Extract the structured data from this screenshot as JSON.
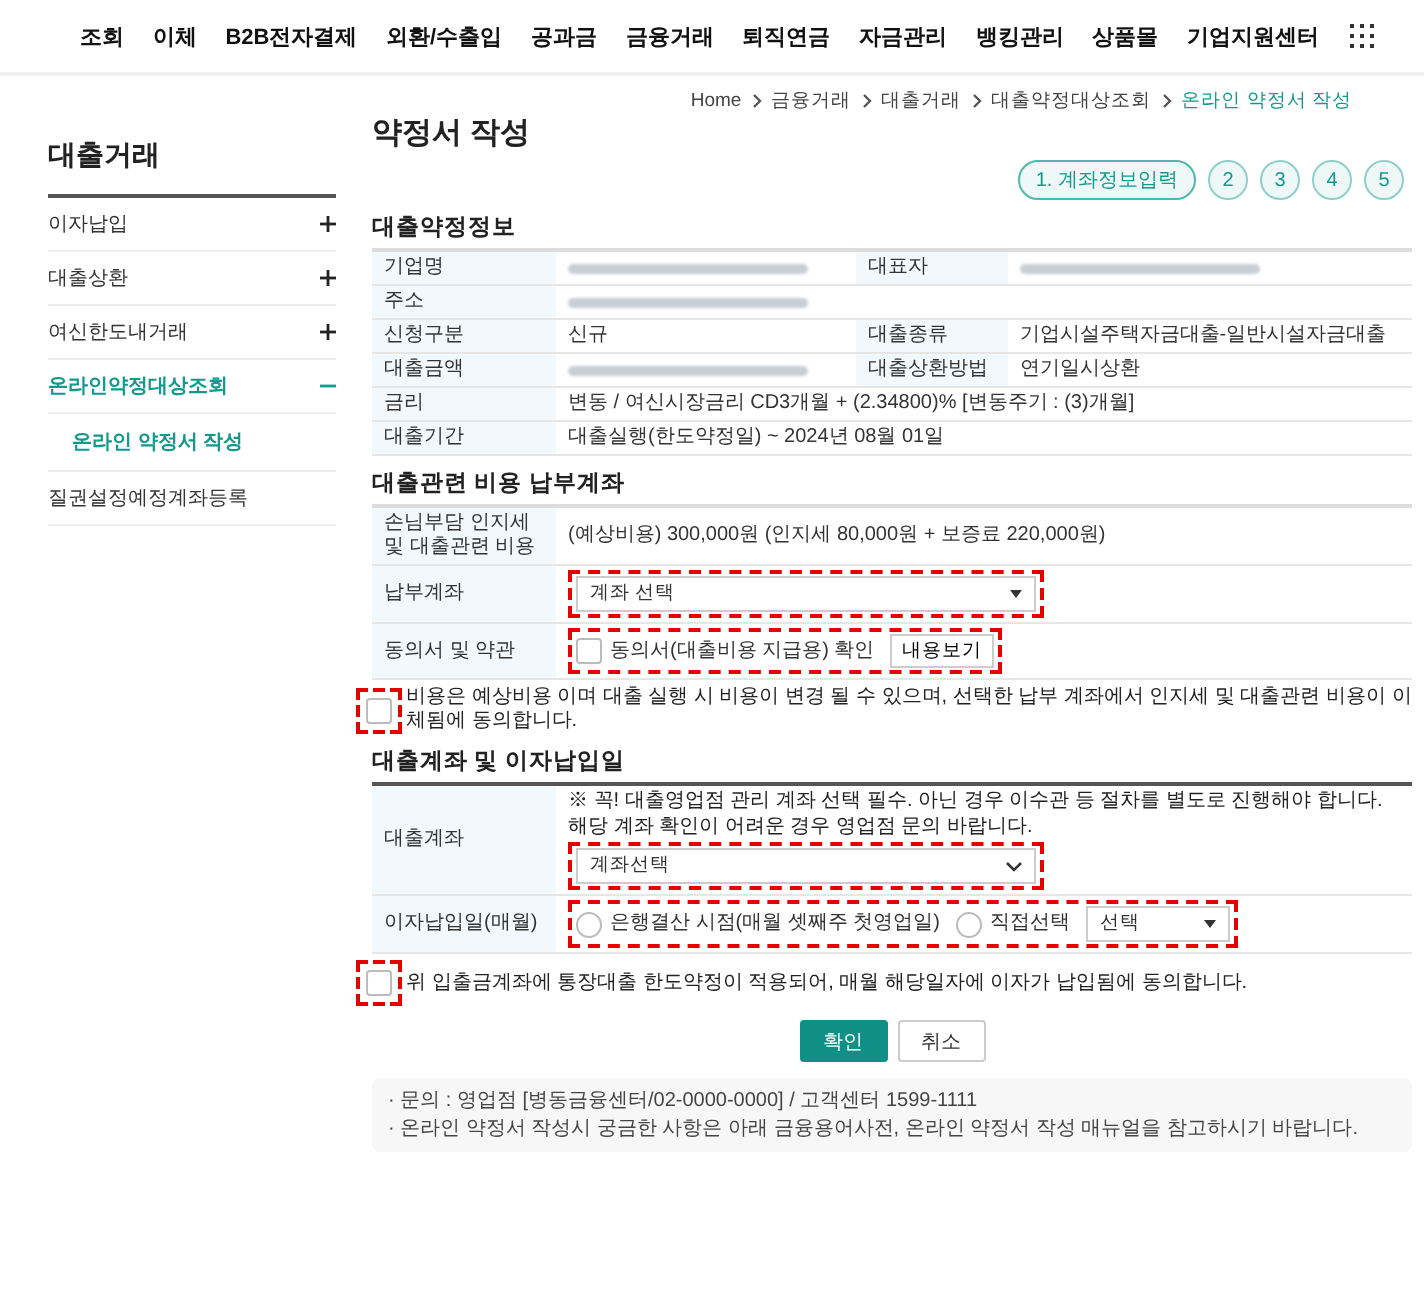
{
  "nav": {
    "items": [
      "조회",
      "이체",
      "B2B전자결제",
      "외환/수출입",
      "공과금",
      "금융거래",
      "퇴직연금",
      "자금관리",
      "뱅킹관리",
      "상품몰",
      "기업지원센터"
    ]
  },
  "breadcrumb": [
    {
      "label": "Home",
      "selected": false
    },
    {
      "label": "금융거래",
      "selected": false
    },
    {
      "label": "대출거래",
      "selected": false
    },
    {
      "label": "대출약정대상조회",
      "selected": false
    },
    {
      "label": "온라인 약정서 작성",
      "selected": true
    }
  ],
  "sidebar": {
    "title": "대출거래",
    "items": [
      {
        "label": "이자납입",
        "kind": "group",
        "expanded": false,
        "selected": false
      },
      {
        "label": "대출상환",
        "kind": "group",
        "expanded": false,
        "selected": false
      },
      {
        "label": "여신한도내거래",
        "kind": "group",
        "expanded": false,
        "selected": false
      },
      {
        "label": "온라인약정대상조회",
        "kind": "group",
        "expanded": true,
        "selected": true,
        "children": [
          {
            "label": "온라인 약정서 작성",
            "selected": true
          }
        ]
      },
      {
        "label": "질권설정예정계좌등록",
        "kind": "link",
        "selected": false
      }
    ]
  },
  "page_title": "약정서 작성",
  "steps": [
    {
      "label": "1. 계좌정보입력",
      "selected": true
    },
    {
      "label": "2",
      "selected": false
    },
    {
      "label": "3",
      "selected": false
    },
    {
      "label": "4",
      "selected": false
    },
    {
      "label": "5",
      "selected": false
    }
  ],
  "loan_info": {
    "title": "대출약정정보",
    "rows": [
      {
        "fields": [
          {
            "label": "기업명",
            "redacted": true
          },
          {
            "label": "대표자",
            "redacted": true
          }
        ]
      },
      {
        "fields": [
          {
            "label": "주소",
            "redacted": true
          }
        ]
      },
      {
        "fields": [
          {
            "label": "신청구분",
            "value": "신규"
          },
          {
            "label": "대출종류",
            "value": "기업시설주택자금대출-일반시설자금대출"
          }
        ]
      },
      {
        "fields": [
          {
            "label": "대출금액",
            "redacted": true
          },
          {
            "label": "대출상환방법",
            "value": "연기일시상환"
          }
        ]
      },
      {
        "fields": [
          {
            "label": "금리",
            "value": "변동 / 여신시장금리 CD3개월 + (2.34800)% [변동주기 : (3)개월]"
          }
        ]
      },
      {
        "fields": [
          {
            "label": "대출기간",
            "value": "대출실행(한도약정일) ~ 2024년 08월 01일"
          }
        ]
      }
    ]
  },
  "fee_account": {
    "title": "대출관련 비용 납부계좌",
    "rows": [
      {
        "kind": "text",
        "label": "손님부담 인지세 및 대출관련 비용",
        "value": "(예상비용) 300,000원 (인지세 80,000원 + 보증료 220,000원)"
      },
      {
        "kind": "select",
        "label": "납부계좌",
        "value": "계좌 선택",
        "highlighted": true
      },
      {
        "kind": "checkbox",
        "label": "동의서 및 약관",
        "option": "동의서(대출비용 지급용) 확인",
        "checked": false,
        "button": "내용보기",
        "highlighted": true
      }
    ],
    "agreement": {
      "text": "비용은 예상비용 이며 대출 실행 시 비용이 변경 될 수 있으며, 선택한 납부 계좌에서 인지세 및 대출관련 비용이 이체됨에 동의합니다.",
      "checked": false,
      "highlighted": true
    }
  },
  "loan_account": {
    "title": "대출계좌 및 이자납입일",
    "rows": [
      {
        "kind": "select",
        "label": "대출계좌",
        "notes": [
          "※ 꼭! 대출영업점 관리 계좌 선택 필수. 아닌 경우 이수관 등 절차를 별도로 진행해야 합니다.",
          "해당 계좌 확인이 어려운 경우 영업점 문의 바랍니다."
        ],
        "value": "계좌선택",
        "highlighted": true
      },
      {
        "kind": "radio",
        "label": "이자납입일(매월)",
        "options": [
          {
            "label": "은행결산 시점(매월 셋째주 첫영업일)",
            "selected": false
          },
          {
            "label": "직접선택",
            "selected": false
          }
        ],
        "value": "선택",
        "highlighted": true
      }
    ],
    "agreement": {
      "text": "위 입출금계좌에 통장대출 한도약정이 적용되어, 매월 해당일자에 이자가 납입됨에 동의합니다.",
      "checked": false,
      "highlighted": true
    }
  },
  "buttons": [
    {
      "label": "확인",
      "kind": "primary"
    },
    {
      "label": "취소",
      "kind": "secondary"
    }
  ],
  "info_box": {
    "lines": [
      "· 문의 : 영업점 [병동금융센터/02-0000-0000] / 고객센터 1599-1111",
      "· 온라인 약정서 작성시 궁금한 사항은 아래 금융용어사전, 온라인 약정서 작성 매뉴얼을 참고하시기 바랍니다."
    ]
  }
}
